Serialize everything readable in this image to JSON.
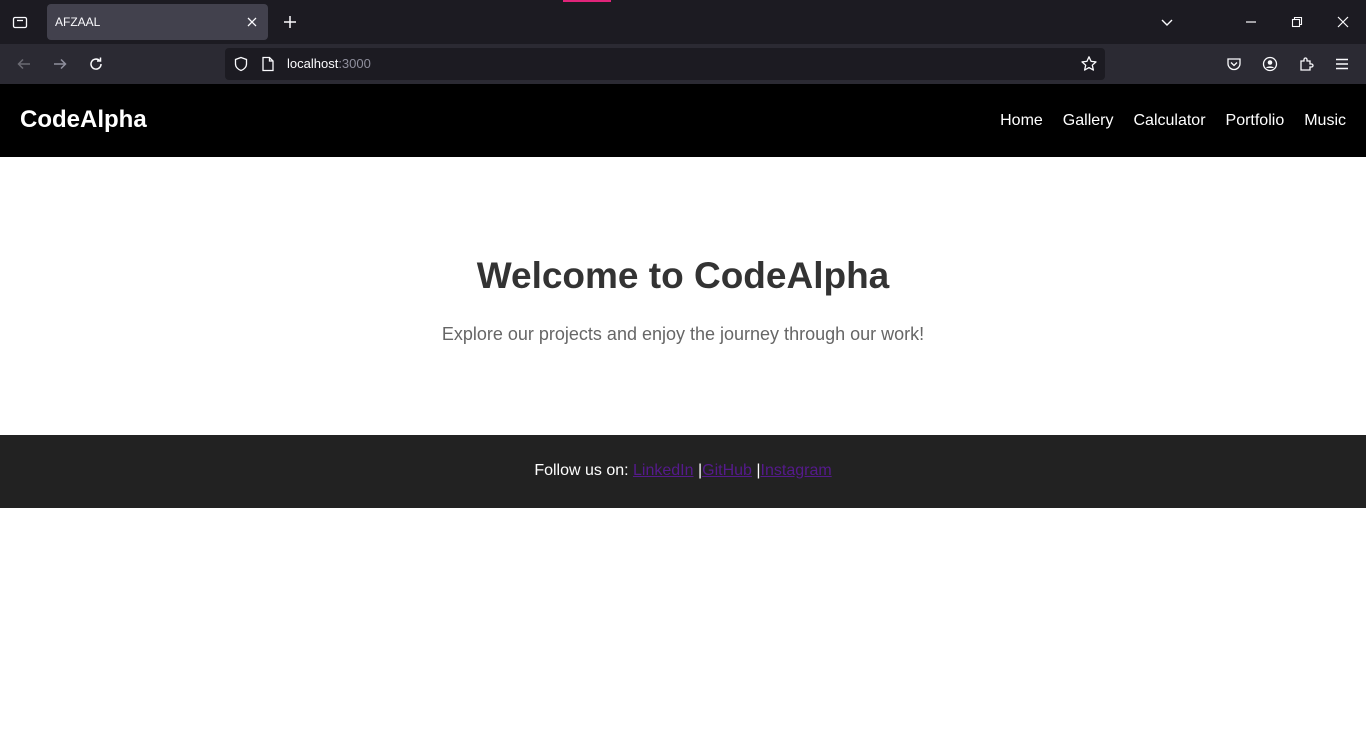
{
  "browser": {
    "tab_title": "AFZAAL",
    "url_host": "localhost",
    "url_port": ":3000",
    "colors": {
      "tab_accent": "#e0247a"
    },
    "icons": [
      "tab-list-icon",
      "close-icon",
      "plus-icon",
      "chevron-down-icon",
      "minimize-icon",
      "restore-icon",
      "window-close-icon",
      "back-icon",
      "forward-icon",
      "reload-icon",
      "shield-icon",
      "page-icon",
      "star-icon",
      "pocket-icon",
      "account-icon",
      "extensions-icon",
      "menu-icon"
    ]
  },
  "site": {
    "logo": "CodeAlpha",
    "nav": [
      "Home",
      "Gallery",
      "Calculator",
      "Portfolio",
      "Music"
    ],
    "hero": {
      "title": "Welcome to CodeAlpha",
      "subtitle": "Explore our projects and enjoy the journey through our work!"
    },
    "footer": {
      "prefix": "Follow us on: ",
      "links": [
        "LinkedIn",
        "GitHub",
        "Instagram"
      ],
      "separator": "|"
    }
  }
}
